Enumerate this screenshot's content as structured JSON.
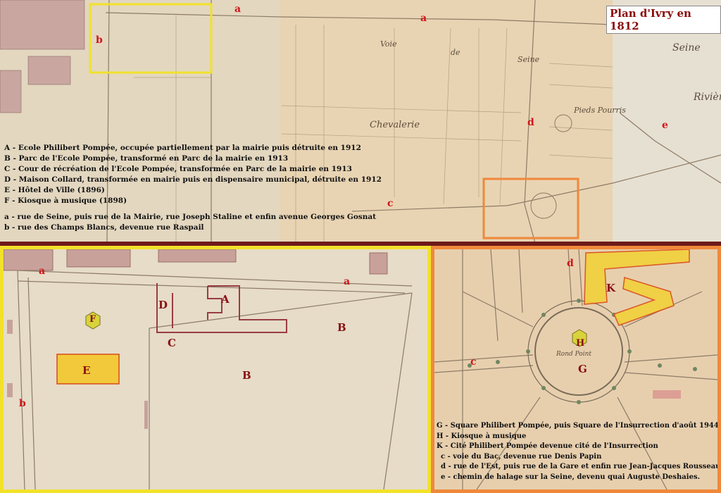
{
  "title": "Plan d'Ivry en 1812",
  "colors": {
    "red_label": "#d0151a",
    "dark_label": "#8a0f14",
    "yellow_frame": "#f2e12a",
    "orange_frame": "#f0883a",
    "divider": "#6e1a1a"
  },
  "top_legend": [
    "A - Ecole Philibert Pompée, occupée partiellement par la mairie puis détruite en 1912",
    "B - Parc de l'Ecole Pompée, transformé en Parc de la mairie en 1913",
    "C - Cour de récréation de l'Ecole Pompée, transformée en Parc de la mairie en 1913",
    "D - Maison Collard, transformée en mairie puis en dispensaire municipal, détruite en 1912",
    "E - Hôtel de Ville (1896)",
    "F - Kiosque à musique (1898)",
    "",
    "a - rue de Seine, puis rue de la Mairie, rue Joseph Staline et enfin avenue Georges Gosnat",
    "b - rue des Champs Blancs, devenue rue Raspail"
  ],
  "br_legend": [
    "G - Square Philibert Pompée, puis Square de l'Insurrection d'août 1944",
    "H - Kiosque à musique",
    "K - Cité Philibert Pompée devenue cité de l'Insurrection",
    "c - voie du Bac, devenue rue Denis Papin",
    "d - rue de l'Est, puis rue de la Gare et enfin rue Jean-Jacques Rousseau",
    "e - chemin de halage sur la Seine, devenu quai Auguste Deshaies."
  ],
  "top_labels": {
    "a1": "a",
    "a2": "a",
    "b": "b",
    "c": "c",
    "d": "d",
    "e": "e"
  },
  "map_words": {
    "voie": "Voie",
    "de": "de",
    "seine": "Seine",
    "chevalerie": "Chevalerie",
    "pieds": "Pieds Pourris",
    "riviere": "Rivière",
    "seine_r": "Seine"
  },
  "bl_labels": {
    "a1": "a",
    "a2": "a",
    "b_lower": "b",
    "A": "A",
    "B1": "B",
    "B2": "B",
    "C": "C",
    "D": "D",
    "E": "E",
    "F": "F"
  },
  "br_labels": {
    "d": "d",
    "K": "K",
    "H": "H",
    "G": "G",
    "c": "c",
    "rond_point": "Rond Point"
  }
}
